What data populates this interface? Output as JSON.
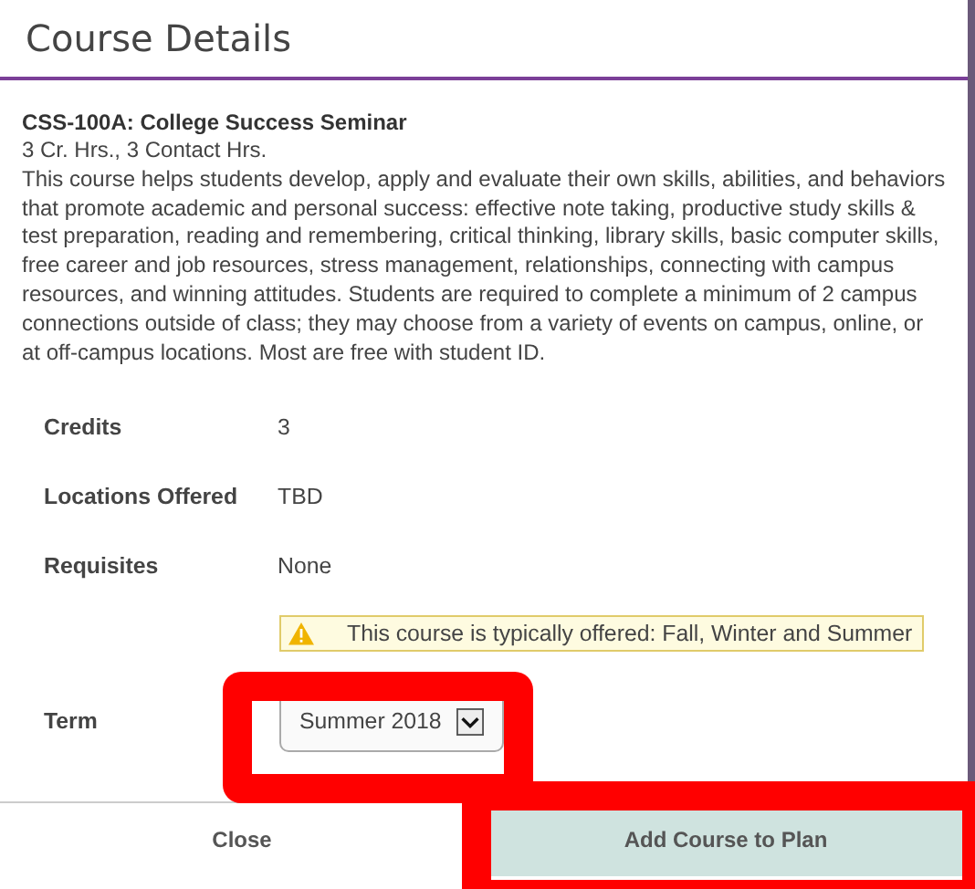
{
  "dialog": {
    "title": "Course Details"
  },
  "course": {
    "heading": "CSS-100A: College Success Seminar",
    "hours": "3 Cr. Hrs., 3 Contact Hrs.",
    "description": "This course helps students develop, apply and evaluate their own skills, abilities, and behaviors that promote academic and personal success: effective note taking, productive study skills & test preparation, reading and remembering, critical thinking, library skills, basic computer skills, free career and job resources, stress management, relationships, connecting with campus resources, and winning attitudes. Students are required to complete a minimum of 2 campus connections outside of class; they may choose from a variety of events on campus, online, or at off-campus locations. Most are free with student ID."
  },
  "details": [
    {
      "label": "Credits",
      "value": "3"
    },
    {
      "label": "Locations Offered",
      "value": "TBD"
    },
    {
      "label": "Requisites",
      "value": "None"
    }
  ],
  "notice": {
    "text": "This course is typically offered: Fall, Winter and Summer"
  },
  "term": {
    "label": "Term",
    "value": "Summer 2018"
  },
  "buttons": [
    {
      "label": "Close",
      "kind": "plain"
    },
    {
      "label": "Add Course to Plan",
      "kind": "primary"
    }
  ]
}
